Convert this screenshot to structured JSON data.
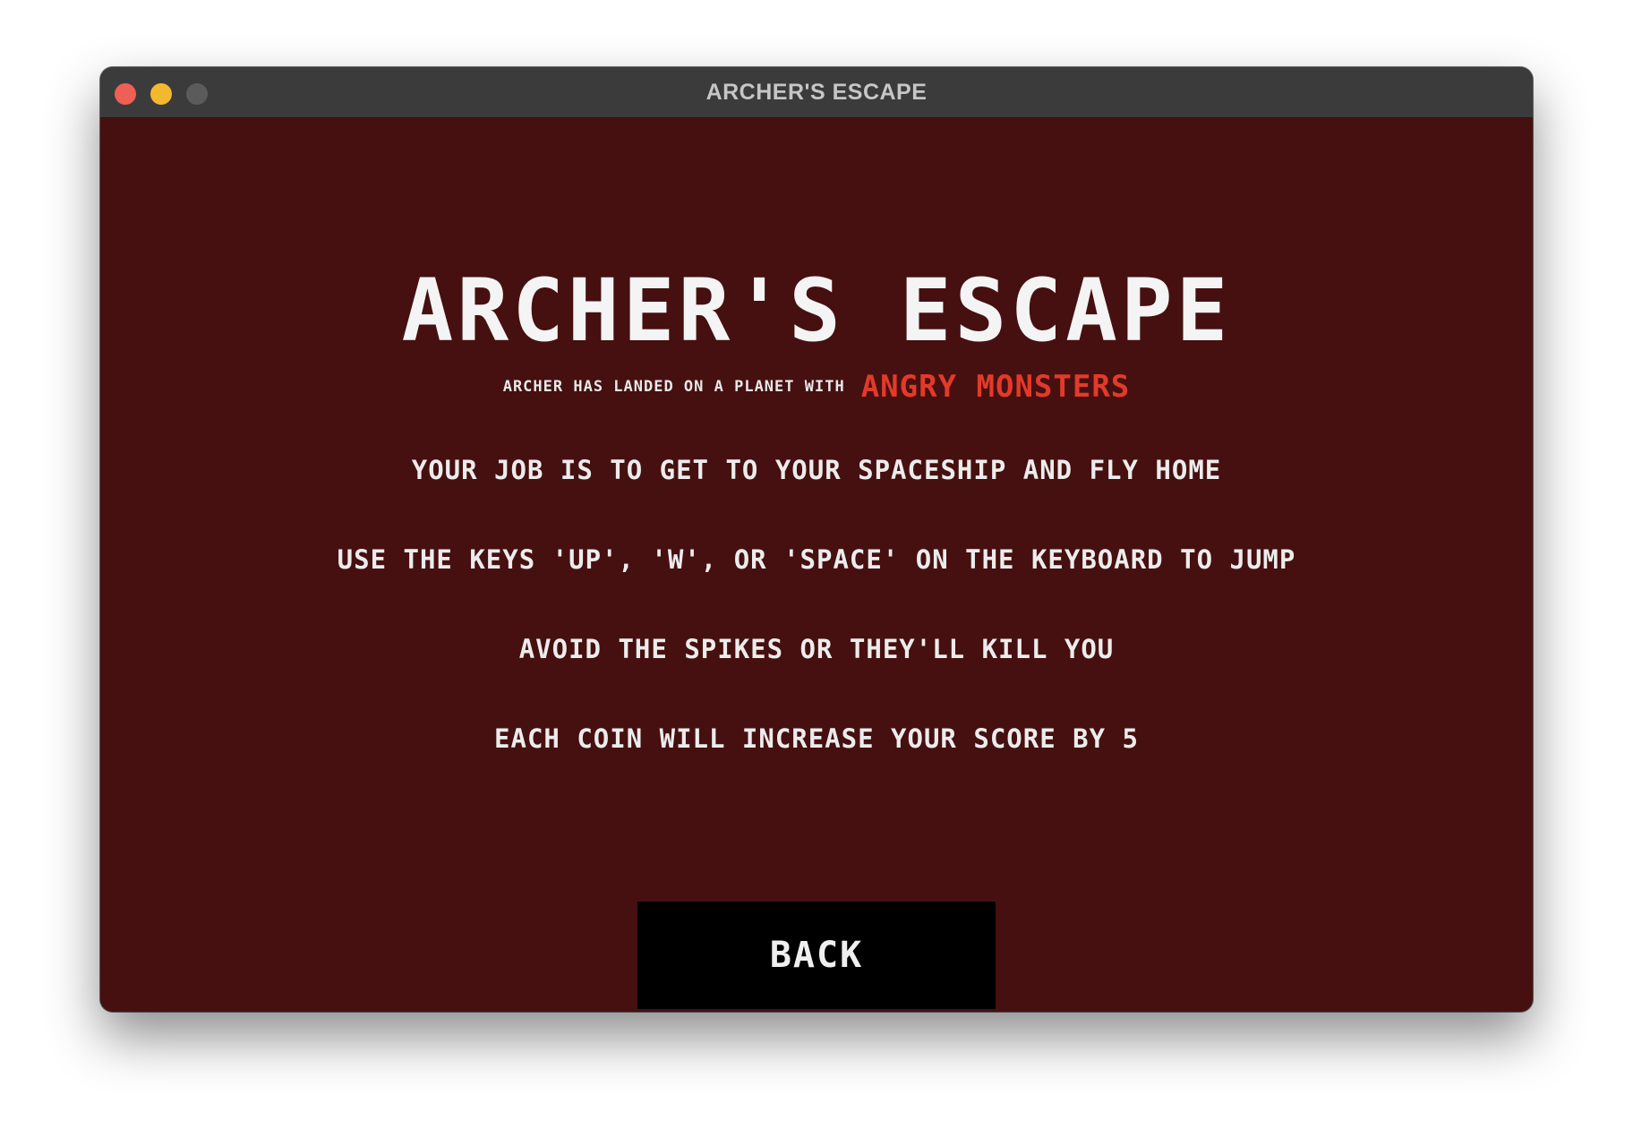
{
  "window": {
    "title": "ARCHER'S ESCAPE"
  },
  "game": {
    "title": "ARCHER'S ESCAPE",
    "intro_text": "ARCHER HAS LANDED ON A PLANET WITH",
    "intro_highlight": "ANGRY MONSTERS",
    "instructions": [
      "YOUR JOB IS TO GET TO YOUR SPACESHIP AND FLY HOME",
      "USE THE KEYS 'UP', 'W', OR 'SPACE' ON THE KEYBOARD TO JUMP",
      "AVOID THE SPIKES OR THEY'LL KILL YOU",
      "EACH COIN WILL INCREASE YOUR SCORE BY 5"
    ],
    "back_label": "BACK"
  },
  "colors": {
    "background": "#461010",
    "highlight": "#e23a2a",
    "text": "#ececec",
    "button": "#000000"
  }
}
